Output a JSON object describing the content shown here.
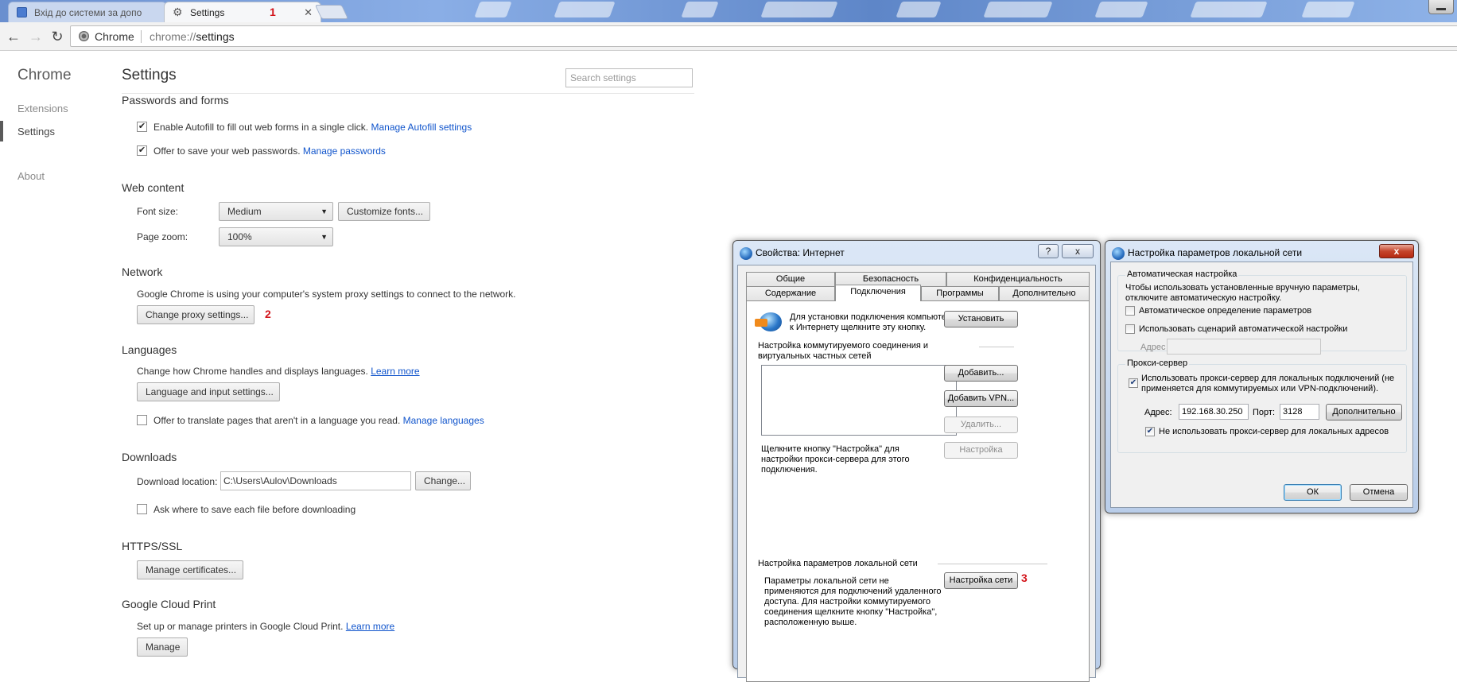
{
  "browser": {
    "tabs": [
      {
        "title": "Вхід до системи за допо"
      },
      {
        "title": "Settings"
      }
    ],
    "marker_1": "1",
    "address": {
      "scheme_label": "Chrome",
      "url_prefix": "chrome://",
      "url_path": "settings"
    }
  },
  "sidebar": {
    "title": "Chrome",
    "items": [
      {
        "label": "Extensions"
      },
      {
        "label": "Settings"
      },
      {
        "label": "About"
      }
    ]
  },
  "settings": {
    "title": "Settings",
    "search_placeholder": "Search settings",
    "passwords": {
      "title": "Passwords and forms",
      "autofill_text": "Enable Autofill to fill out web forms in a single click.",
      "autofill_link": "Manage Autofill settings",
      "save_text": "Offer to save your web passwords.",
      "save_link": "Manage passwords"
    },
    "web_content": {
      "title": "Web content",
      "font_size_label": "Font size:",
      "font_size_value": "Medium",
      "customize_fonts": "Customize fonts...",
      "page_zoom_label": "Page zoom:",
      "page_zoom_value": "100%"
    },
    "network": {
      "title": "Network",
      "text": "Google Chrome is using your computer's system proxy settings to connect to the network.",
      "button": "Change proxy settings...",
      "marker": "2"
    },
    "languages": {
      "title": "Languages",
      "text": "Change how Chrome handles and displays languages.",
      "learn_more": "Learn more",
      "button": "Language and input settings...",
      "translate_text": "Offer to translate pages that aren't in a language you read.",
      "translate_link": "Manage languages"
    },
    "downloads": {
      "title": "Downloads",
      "location_label": "Download location:",
      "location_value": "C:\\Users\\Aulov\\Downloads",
      "change_button": "Change...",
      "ask_text": "Ask where to save each file before downloading"
    },
    "https": {
      "title": "HTTPS/SSL",
      "button": "Manage certificates..."
    },
    "cloud_print": {
      "title": "Google Cloud Print",
      "text": "Set up or manage printers in Google Cloud Print.",
      "learn_more": "Learn more",
      "button": "Manage"
    }
  },
  "inet_dialog": {
    "title": "Свойства: Интернет",
    "help_btn": "?",
    "close_btn": "x",
    "tabs_row1": [
      "Общие",
      "Безопасность",
      "Конфиденциальность"
    ],
    "tabs_row2": [
      "Содержание",
      "Подключения",
      "Программы",
      "Дополнительно"
    ],
    "setup_text": "Для установки подключения компьютера к Интернету щелкните эту кнопку.",
    "setup_button": "Установить",
    "dialup_title": "Настройка коммутируемого соединения и виртуальных частных сетей",
    "add_button": "Добавить...",
    "add_vpn_button": "Добавить VPN...",
    "remove_button": "Удалить...",
    "settings_button": "Настройка",
    "proxy_hint": "Щелкните кнопку \"Настройка\" для настройки прокси-сервера для этого подключения.",
    "lan_title": "Настройка параметров локальной сети",
    "lan_text": "Параметры локальной сети не применяются для подключений удаленного доступа. Для настройки коммутируемого соединения щелкните кнопку \"Настройка\", расположенную выше.",
    "lan_button": "Настройка сети",
    "marker": "3"
  },
  "lan_dialog": {
    "title": "Настройка параметров локальной сети",
    "close_btn": "x",
    "auto_group_title": "Автоматическая настройка",
    "auto_text": "Чтобы использовать установленные вручную параметры, отключите автоматическую настройку.",
    "auto_detect_label": "Автоматическое определение параметров",
    "auto_script_label": "Использовать сценарий автоматической настройки",
    "address_label": "Адрес",
    "proxy_group_title": "Прокси-сервер",
    "use_proxy_label": "Использовать прокси-сервер для локальных подключений (не применяется для коммутируемых или VPN-подключений).",
    "proxy_address_label": "Адрес:",
    "proxy_address_value": "192.168.30.250",
    "port_label": "Порт:",
    "port_value": "3128",
    "advanced_button": "Дополнительно",
    "bypass_label": "Не использовать прокси-сервер для локальных адресов",
    "ok_button": "ОК",
    "cancel_button": "Отмена"
  },
  "colors": {
    "link": "#1155cc",
    "marker": "#d3141b",
    "titlebar": "#b9cde9"
  }
}
